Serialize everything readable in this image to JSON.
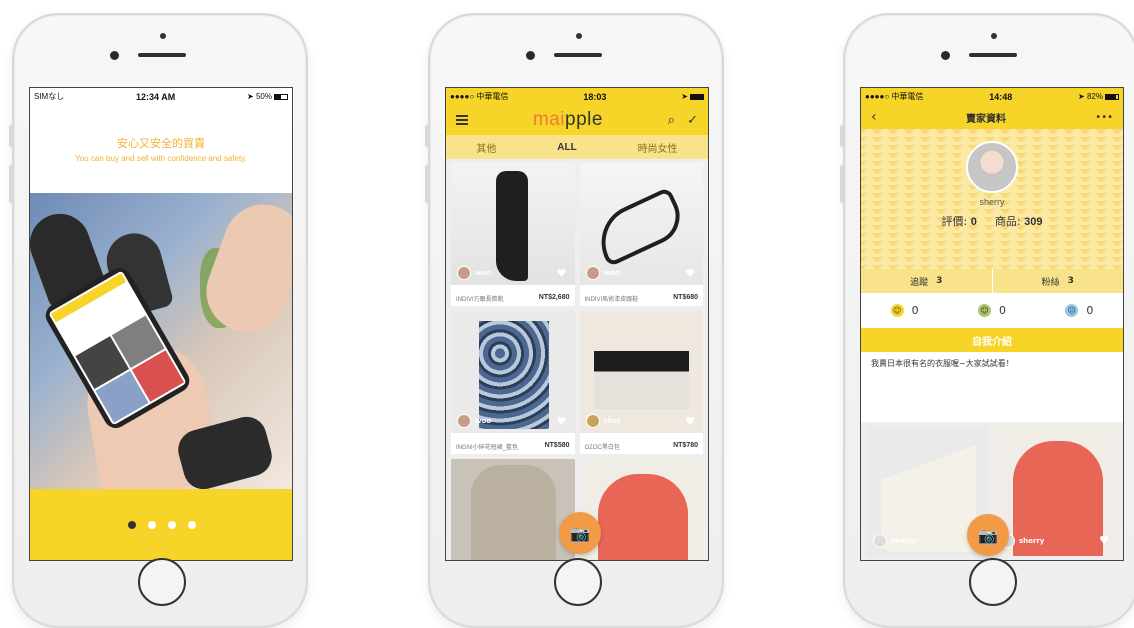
{
  "phone1": {
    "status": {
      "carrier": "SIMなし",
      "time": "12:34 AM",
      "battery": "50%"
    },
    "title": "安心又安全的買賣",
    "subtitle": "You can buy and sell with confidence and safety.",
    "pager_count": 4
  },
  "phone2": {
    "status": {
      "carrier": "●●●●○ 中華電信",
      "time": "18:03"
    },
    "brand": {
      "part1": "mai",
      "part2": "pple"
    },
    "tabs": [
      {
        "label": "其他"
      },
      {
        "label": "ALL"
      },
      {
        "label": "時尚女性"
      }
    ],
    "products": [
      {
        "seller": "woo",
        "name": "INDIVI方跟長筒靴",
        "price": "NT$2,680"
      },
      {
        "seller": "woo",
        "name": "INDIVI馬術漆皮跟鞋",
        "price": "NT$680"
      },
      {
        "seller": "woo",
        "name": "INGNI小碎花短裙_藍色",
        "price": "NT$580"
      },
      {
        "seller": "cher",
        "name": "OZOC黑白包",
        "price": "NT$780"
      }
    ]
  },
  "phone3": {
    "status": {
      "carrier": "●●●●○ 中華電信",
      "time": "14:48",
      "battery": "82%"
    },
    "title": "賣家資料",
    "username": "sherry",
    "rating_label": "評價:",
    "rating_value": "0",
    "goods_label": "商品:",
    "goods_value": "309",
    "following_label": "追蹤",
    "following_value": "3",
    "followers_label": "粉絲",
    "followers_value": "3",
    "reviews": [
      {
        "count": "0"
      },
      {
        "count": "0"
      },
      {
        "count": "0"
      }
    ],
    "intro_title": "自我介紹",
    "intro_text": "我賣日本很有名的衣服喔~大家試試看！",
    "products": [
      {
        "seller": "sherry"
      },
      {
        "seller": "sherry"
      }
    ]
  },
  "colors": {
    "brand_yellow": "#f6d528",
    "accent_orange": "#f29a45",
    "tab_yellow": "#f9e38a"
  }
}
